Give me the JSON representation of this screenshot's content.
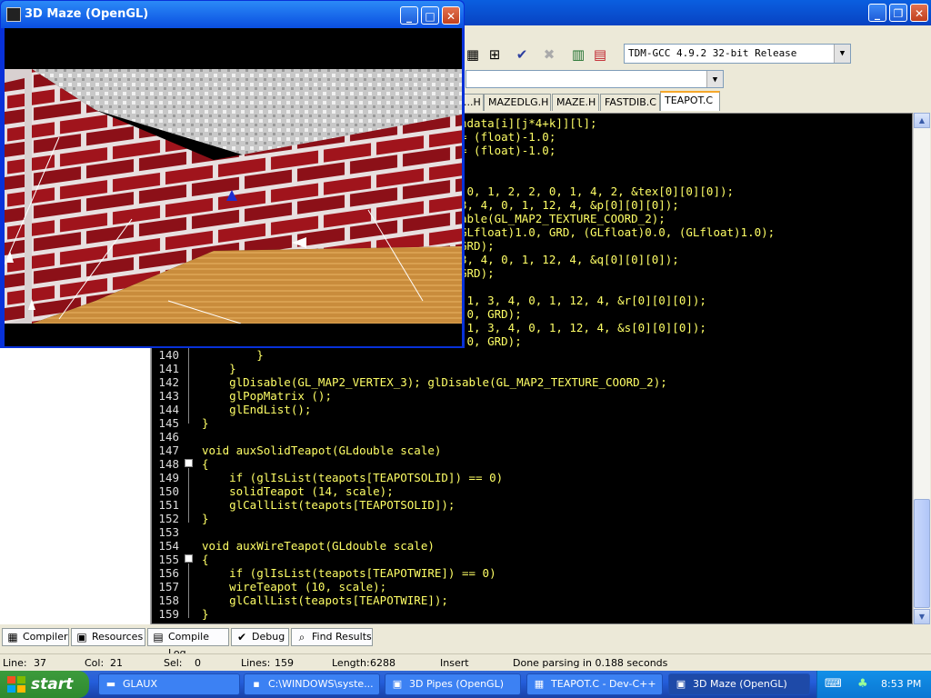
{
  "devcpp": {
    "compiler_combo": "TDM-GCC 4.9.2 32-bit Release",
    "file_tabs": [
      {
        "label": "...H"
      },
      {
        "label": "MAZEDLG.H"
      },
      {
        "label": "MAZE.H"
      },
      {
        "label": "FASTDIB.C"
      },
      {
        "label": "TEAPOT.C"
      }
    ],
    "code_lines": [
      {
        "num": "",
        "text": "ndata[i][j*4+k]][l];"
      },
      {
        "num": "",
        "text": "= (float)-1.0;"
      },
      {
        "num": "",
        "text": "= (float)-1.0;"
      },
      {
        "num": "",
        "text": ""
      },
      {
        "num": "",
        "text": ""
      },
      {
        "num": "",
        "text": " 0, 1, 2, 2, 0, 1, 4, 2, &tex[0][0][0]);"
      },
      {
        "num": "",
        "text": "3, 4, 0, 1, 12, 4, &p[0][0][0]);"
      },
      {
        "num": "",
        "text": "able(GL_MAP2_TEXTURE_COORD_2);"
      },
      {
        "num": "",
        "text": "GLfloat)1.0, GRD, (GLfloat)0.0, (GLfloat)1.0);"
      },
      {
        "num": "",
        "text": "GRD);"
      },
      {
        "num": "",
        "text": "3, 4, 0, 1, 12, 4, &q[0][0][0]);"
      },
      {
        "num": "",
        "text": "GRD);"
      },
      {
        "num": "",
        "text": ""
      },
      {
        "num": "",
        "text": " 1, 3, 4, 0, 1, 12, 4, &r[0][0][0]);"
      },
      {
        "num": "",
        "text": " 0, GRD);"
      },
      {
        "num": "",
        "text": " 1, 3, 4, 0, 1, 12, 4, &s[0][0][0]);"
      },
      {
        "num": "",
        "text": " 0, GRD);"
      },
      {
        "num": "140",
        "text": "        }"
      },
      {
        "num": "141",
        "text": "    }"
      },
      {
        "num": "142",
        "text": "    glDisable(GL_MAP2_VERTEX_3); glDisable(GL_MAP2_TEXTURE_COORD_2);"
      },
      {
        "num": "143",
        "text": "    glPopMatrix ();"
      },
      {
        "num": "144",
        "text": "    glEndList();"
      },
      {
        "num": "145",
        "text": "}"
      },
      {
        "num": "146",
        "text": ""
      },
      {
        "num": "147",
        "text": "void auxSolidTeapot(GLdouble scale)"
      },
      {
        "num": "148",
        "text": "{"
      },
      {
        "num": "149",
        "text": "    if (glIsList(teapots[TEAPOTSOLID]) == 0)"
      },
      {
        "num": "150",
        "text": "    solidTeapot (14, scale);"
      },
      {
        "num": "151",
        "text": "    glCallList(teapots[TEAPOTSOLID]);"
      },
      {
        "num": "152",
        "text": "}"
      },
      {
        "num": "153",
        "text": ""
      },
      {
        "num": "154",
        "text": "void auxWireTeapot(GLdouble scale)"
      },
      {
        "num": "155",
        "text": "{"
      },
      {
        "num": "156",
        "text": "    if (glIsList(teapots[TEAPOTWIRE]) == 0)"
      },
      {
        "num": "157",
        "text": "    wireTeapot (10, scale);"
      },
      {
        "num": "158",
        "text": "    glCallList(teapots[TEAPOTWIRE]);"
      },
      {
        "num": "159",
        "text": "}"
      }
    ],
    "bottom_tabs": [
      {
        "label": "Compiler",
        "icon": "compiler-icon"
      },
      {
        "label": "Resources",
        "icon": "resources-icon"
      },
      {
        "label": "Compile Log",
        "icon": "compile-log-icon"
      },
      {
        "label": "Debug",
        "icon": "debug-icon"
      },
      {
        "label": "Find Results",
        "icon": "find-results-icon"
      }
    ],
    "status": {
      "line_label": "Line:",
      "line_value": "37",
      "col_label": "Col:",
      "col_value": "21",
      "sel_label": "Sel:",
      "sel_value": "0",
      "lines_label": "Lines:",
      "lines_value": "159",
      "length_label": "Length:",
      "length_value": "6288",
      "insert_mode": "Insert",
      "message": "Done parsing in 0.188 seconds"
    }
  },
  "maze_window": {
    "title": "3D Maze (OpenGL)"
  },
  "taskbar": {
    "start_label": "start",
    "tasks": [
      {
        "label": "GLAUX",
        "icon": "folder-icon"
      },
      {
        "label": "C:\\WINDOWS\\syste...",
        "icon": "console-icon"
      },
      {
        "label": "3D Pipes (OpenGL)",
        "icon": "app-icon"
      },
      {
        "label": "TEAPOT.C - Dev-C++",
        "icon": "devcpp-icon"
      },
      {
        "label": "3D Maze (OpenGL)",
        "icon": "app-icon"
      }
    ],
    "clock": "8:53 PM"
  }
}
